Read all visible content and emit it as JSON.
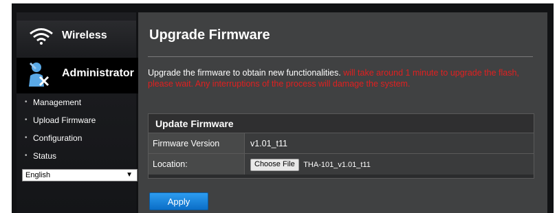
{
  "sidebar": {
    "wireless": {
      "label": "Wireless",
      "icon": "wifi-icon"
    },
    "administrator": {
      "label": "Administrator",
      "icon": "admin-tools-icon"
    },
    "items": [
      {
        "label": "Management"
      },
      {
        "label": "Upload Firmware"
      },
      {
        "label": "Configuration"
      },
      {
        "label": "Status"
      }
    ],
    "language": {
      "selected": "English",
      "arrow": "▼"
    }
  },
  "main": {
    "title": "Upgrade Firmware",
    "description": "Upgrade the firmware to obtain new functionalities. ",
    "warning": "will take around 1 minute to upgrade the flash, please wait. Any interruptions of the process will damage the system.",
    "panel": {
      "header": "Update Firmware",
      "firmware_label": "Firmware Version",
      "firmware_value": "v1.01_t11",
      "location_label": "Location:",
      "choose_file": "Choose File",
      "file_name": "THA-101_v1.01_t11"
    },
    "apply_label": "Apply"
  },
  "colors": {
    "warning": "#e02020",
    "accent": "#1a86de"
  }
}
